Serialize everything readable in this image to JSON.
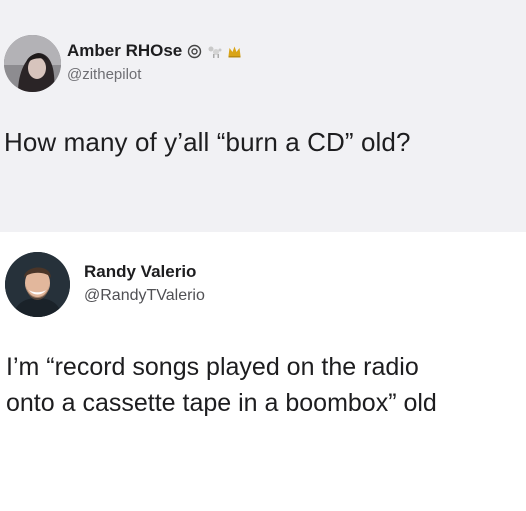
{
  "tweet1": {
    "display_name": "Amber RHOse",
    "name_emojis": [
      "camera-icon",
      "poodle-icon",
      "crown-icon"
    ],
    "handle": "@zithepilot",
    "text": "How many of y’all “burn a CD” old?"
  },
  "tweet2": {
    "display_name": "Randy Valerio",
    "handle": "@RandyTValerio",
    "text_lines": [
      "I’m “record songs played on the radio",
      "onto a cassette tape in a boombox” old"
    ]
  },
  "colors": {
    "tweet1_background": "#f1f1f4",
    "tweet2_background": "#ffffff",
    "primary_text": "#1d1d1f",
    "secondary_text": "#6e6e73"
  }
}
